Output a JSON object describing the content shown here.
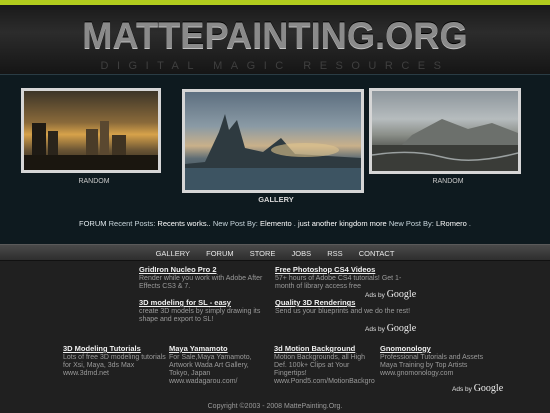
{
  "header": {
    "logo": "MATTEPAINTING.ORG",
    "tagline": "DIGITAL MAGIC RESOURCES",
    "accent_color": "#b2cc1e"
  },
  "thumbs": [
    {
      "label": "RANDOM"
    },
    {
      "label": "GALLERY"
    },
    {
      "label": "RANDOM"
    }
  ],
  "forum": {
    "label": "FORUM",
    "prefix": "Recent Posts:",
    "posts": [
      {
        "title": "Recents works..",
        "by": "New Post By:",
        "author": "Elemento"
      },
      {
        "title": "just another kingdom more",
        "by": "New Post By:",
        "author": "LRomero"
      }
    ]
  },
  "nav": [
    "GALLERY",
    "FORUM",
    "STORE",
    "JOBS",
    "RSS",
    "CONTACT"
  ],
  "ads_top": [
    {
      "title": "GridIron Nucleo Pro 2",
      "desc": "Render while you work with Adobe After Effects CS3 & 7."
    },
    {
      "title": "Free Photoshop CS4 Videos",
      "desc": "57+ hours of Adobe CS4 tutorials! Get 1-month of library access free"
    },
    {
      "title": "3D modeling for SL - easy",
      "desc": "create 3D models by simply drawing its shape and export to SL!"
    },
    {
      "title": "Quality 3D Renderings",
      "desc": "Send us your blueprints and we do the rest!"
    }
  ],
  "ads_bottom": [
    {
      "title": "3D Modeling Tutorials",
      "desc": "Lots of free 3D modeling tutorials for Xsi, Maya, 3ds Max",
      "url": "www.3dmd.net"
    },
    {
      "title": "Maya Yamamoto",
      "desc": "For Sale,Maya Yamamoto, Artwork Wada Art Gallery, Tokyo, Japan",
      "url": "www.wadagarou.com/"
    },
    {
      "title": "3d Motion Background",
      "desc": "Motion Backgrounds, all High Def. 100k+ Clips at Your Fingertips!",
      "url": "www.Pond5.com/MotionBackgro"
    },
    {
      "title": "Gnomonology",
      "desc": "Professional Tutorials and Assets Maya Training by Top Artists",
      "url": "www.gnomonology.com"
    }
  ],
  "adsby": {
    "text": "Ads by",
    "brand": "Google"
  },
  "copyright": "Copyright ©2003 - 2008 MattePainting.Org."
}
